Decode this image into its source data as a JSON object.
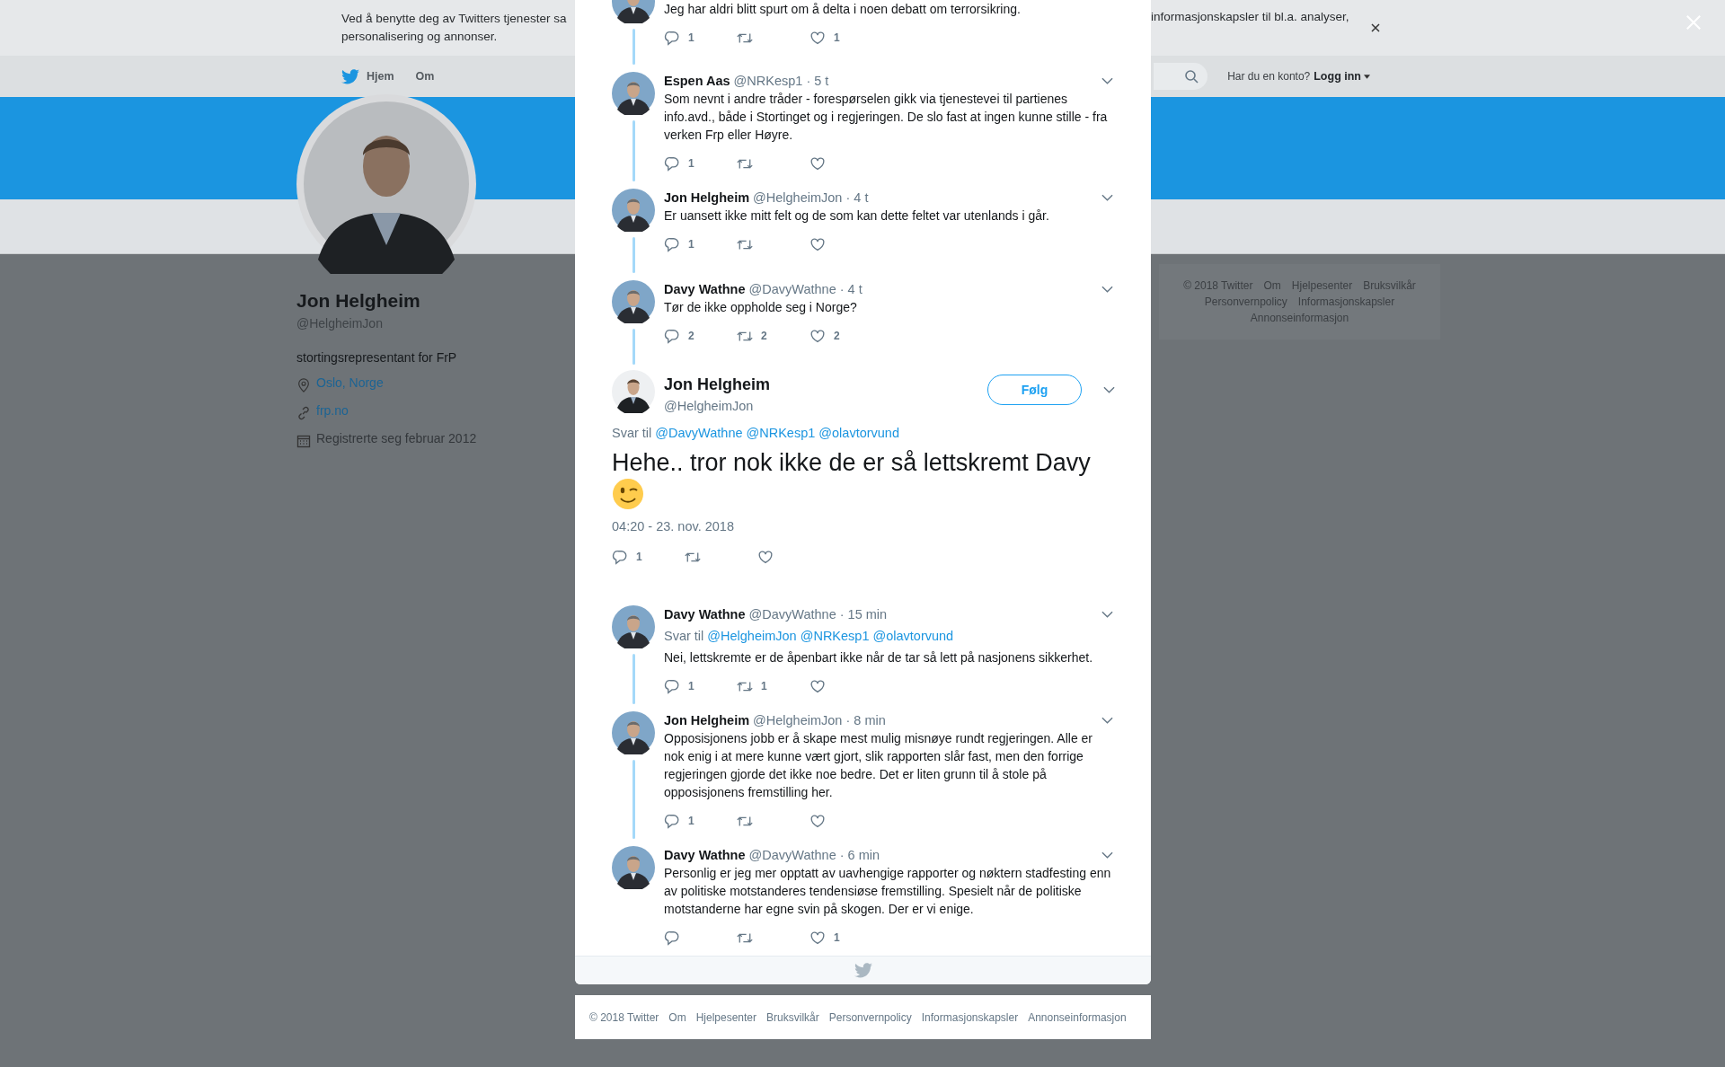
{
  "cookie_bar": {
    "text_left": "Ved å benytte deg av Twitters tjenester sa",
    "text_left_line2": "personalisering og annonser.",
    "text_right": "informasjonskapsler til bl.a. analyser,"
  },
  "nav": {
    "items": [
      "Hjem",
      "Om"
    ],
    "login_prompt": "Har du en konto?",
    "login": "Logg inn"
  },
  "profile": {
    "name": "Jon Helgheim",
    "handle": "@HelgheimJon",
    "bio": "stortingsrepresentant for FrP",
    "location": "Oslo, Norge",
    "url": "frp.no",
    "joined": "Registrerte seg februar 2012"
  },
  "side_footer": [
    "© 2018 Twitter",
    "Om",
    "Hjelpesenter",
    "Bruksvilkår",
    "Personvernpolicy",
    "Informasjonskapsler",
    "Annonseinformasjon"
  ],
  "replies_above": [
    {
      "text": "Jeg har aldri blitt spurt om å delta i noen debatt om terrorsikring.",
      "replies": "1",
      "likes": "1",
      "thread_line": true
    },
    {
      "name": "Espen Aas",
      "handle": "@NRKesp1",
      "time": "· 5 t",
      "text": "Som nevnt i andre tråder - forespørselen gikk via tjenestevei til partienes info.avd., både i Stortinget og i regjeringen. De slo fast at ingen kunne stille - fra verken Frp eller Høyre.",
      "replies": "1",
      "thread_line": true
    },
    {
      "name": "Jon Helgheim",
      "handle": "@HelgheimJon",
      "time": "· 4 t",
      "text": "Er uansett ikke mitt felt og de som kan dette feltet var utenlands i går.",
      "replies": "1",
      "thread_line": true
    },
    {
      "name": "Davy Wathne",
      "handle": "@DavyWathne",
      "time": "· 4 t",
      "text": "Tør de ikke oppholde seg i Norge?",
      "replies": "2",
      "retweets": "2",
      "likes": "2",
      "thread_line": true
    }
  ],
  "main_tweet": {
    "name": "Jon Helgheim",
    "handle": "@HelgheimJon",
    "follow": "Følg",
    "reply_label": "Svar til",
    "reply_to": [
      "@DavyWathne",
      "@NRKesp1",
      "@olavtorvund"
    ],
    "text": "Hehe.. tror nok ikke de er så lettskremt Davy",
    "date": "04:20 - 23. nov. 2018",
    "replies": "1"
  },
  "replies_below": [
    {
      "name": "Davy Wathne",
      "handle": "@DavyWathne",
      "time": "· 15 min",
      "reply_label": "Svar til",
      "reply_to": [
        "@HelgheimJon",
        "@NRKesp1",
        "@olavtorvund"
      ],
      "text": "Nei, lettskremte er de åpenbart ikke når de tar så lett på nasjonens sikkerhet.",
      "replies": "1",
      "retweets": "1",
      "thread_line": true
    },
    {
      "name": "Jon Helgheim",
      "handle": "@HelgheimJon",
      "time": "· 8 min",
      "text": "Opposisjonens jobb er å skape mest mulig misnøye rundt regjeringen. Alle er nok enig i at mere kunne vært gjort, slik rapporten slår fast, men den forrige regjeringen gjorde det ikke noe bedre. Det er liten grunn til å stole på opposisjonens fremstilling her.",
      "replies": "1",
      "thread_line": true
    },
    {
      "name": "Davy Wathne",
      "handle": "@DavyWathne",
      "time": "· 6 min",
      "text": "Personlig er jeg mer opptatt av uavhengige rapporter og nøktern stadfesting enn av politiske motstanderes tendensiøse fremstilling. Spesielt når de politiske motstanderne har egne svin på skogen. Der er vi enige.",
      "likes": "1",
      "thread_line": false
    }
  ],
  "footer": [
    "© 2018 Twitter",
    "Om",
    "Hjelpesenter",
    "Bruksvilkår",
    "Personvernpolicy",
    "Informasjonskapsler",
    "Annonseinformasjon"
  ]
}
